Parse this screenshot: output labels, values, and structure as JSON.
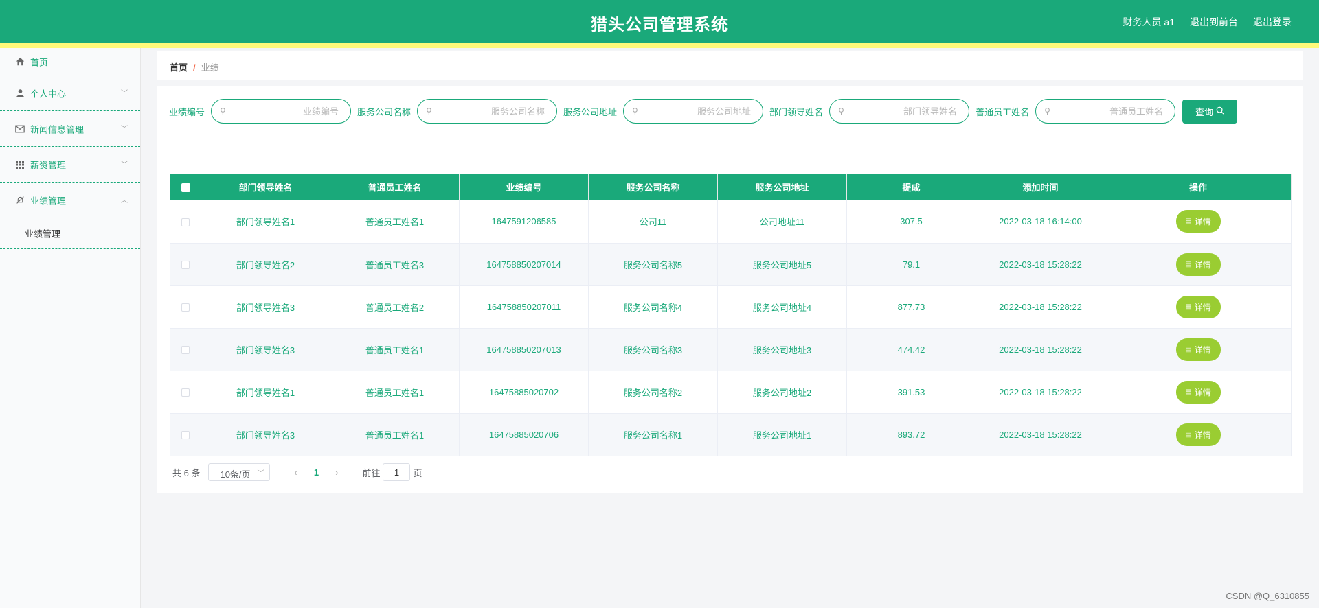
{
  "header": {
    "title": "猎头公司管理系统",
    "user": "财务人员 a1",
    "to_front": "退出到前台",
    "logout": "退出登录"
  },
  "sidebar": {
    "items": [
      {
        "label": "首页",
        "icon": "home-icon"
      },
      {
        "label": "个人中心",
        "icon": "user-icon"
      },
      {
        "label": "新闻信息管理",
        "icon": "mail-icon"
      },
      {
        "label": "薪资管理",
        "icon": "grid-icon"
      },
      {
        "label": "业绩管理",
        "icon": "bell-off-icon"
      }
    ],
    "sub_item": "业绩管理"
  },
  "breadcrumb": {
    "home": "首页",
    "separator": "/",
    "current": "业绩"
  },
  "search": {
    "fields": [
      {
        "label": "业绩编号",
        "placeholder": "业绩编号"
      },
      {
        "label": "服务公司名称",
        "placeholder": "服务公司名称"
      },
      {
        "label": "服务公司地址",
        "placeholder": "服务公司地址"
      },
      {
        "label": "部门领导姓名",
        "placeholder": "部门领导姓名"
      },
      {
        "label": "普通员工姓名",
        "placeholder": "普通员工姓名"
      }
    ],
    "button": "查询"
  },
  "table": {
    "columns": [
      "部门领导姓名",
      "普通员工姓名",
      "业绩编号",
      "服务公司名称",
      "服务公司地址",
      "提成",
      "添加时间",
      "操作"
    ],
    "rows": [
      [
        "部门领导姓名1",
        "普通员工姓名1",
        "1647591206585",
        "公司11",
        "公司地址11",
        "307.5",
        "2022-03-18 16:14:00"
      ],
      [
        "部门领导姓名2",
        "普通员工姓名3",
        "164758850207014",
        "服务公司名称5",
        "服务公司地址5",
        "79.1",
        "2022-03-18 15:28:22"
      ],
      [
        "部门领导姓名3",
        "普通员工姓名2",
        "164758850207011",
        "服务公司名称4",
        "服务公司地址4",
        "877.73",
        "2022-03-18 15:28:22"
      ],
      [
        "部门领导姓名3",
        "普通员工姓名1",
        "164758850207013",
        "服务公司名称3",
        "服务公司地址3",
        "474.42",
        "2022-03-18 15:28:22"
      ],
      [
        "部门领导姓名1",
        "普通员工姓名1",
        "16475885020702",
        "服务公司名称2",
        "服务公司地址2",
        "391.53",
        "2022-03-18 15:28:22"
      ],
      [
        "部门领导姓名3",
        "普通员工姓名1",
        "16475885020706",
        "服务公司名称1",
        "服务公司地址1",
        "893.72",
        "2022-03-18 15:28:22"
      ]
    ],
    "detail_label": "详情"
  },
  "pagination": {
    "total": "共 6 条",
    "page_size": "10条/页",
    "current_page": "1",
    "goto_prefix": "前往",
    "goto_value": "1",
    "goto_suffix": "页"
  },
  "watermark": "CSDN @Q_6310855",
  "colors": {
    "primary": "#1aa97a",
    "accent_strip": "#fffa7a",
    "detail_button": "#9acd32"
  }
}
